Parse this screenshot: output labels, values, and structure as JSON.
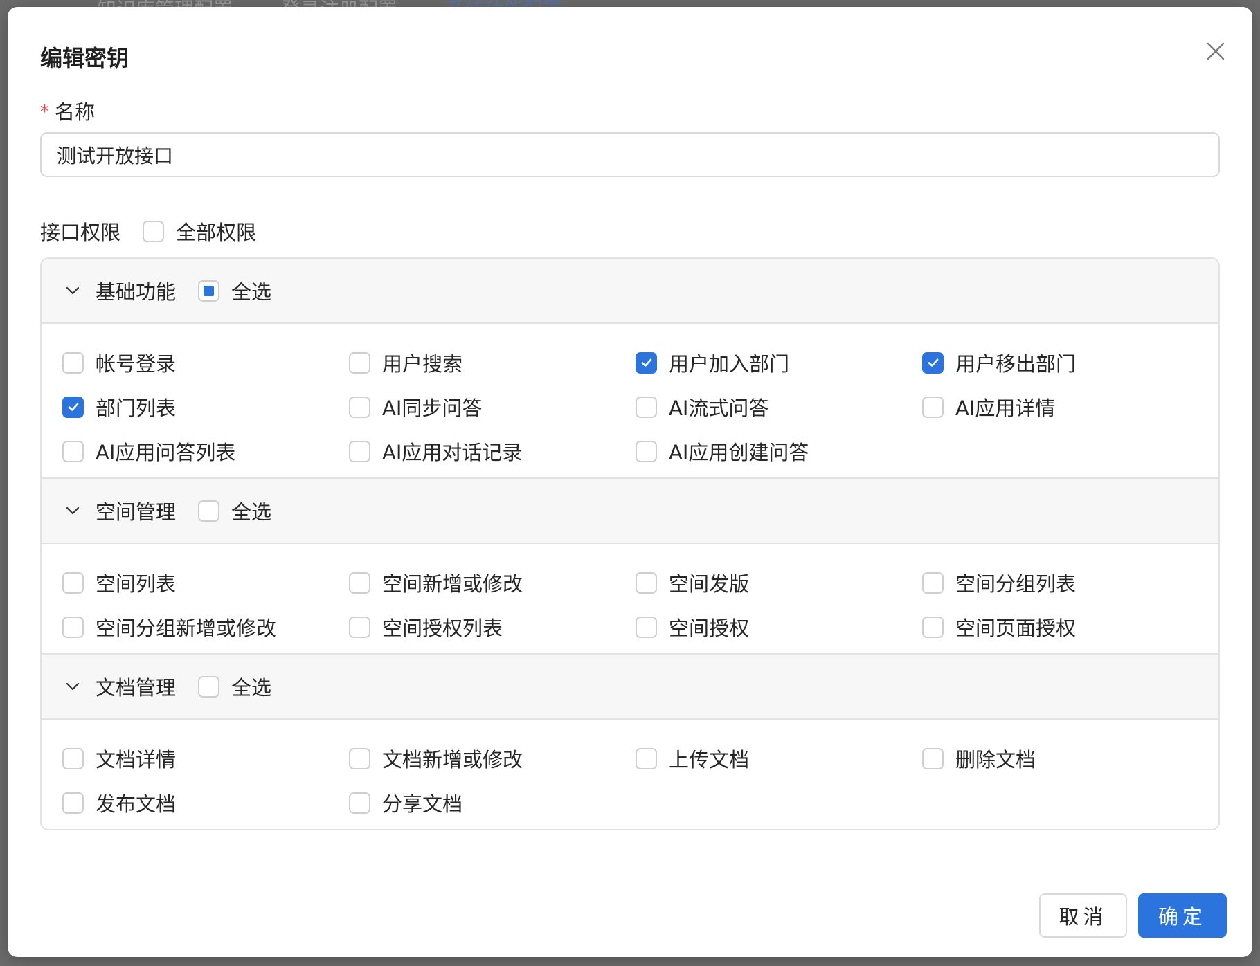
{
  "background_tabs": [
    "知识库管理配置",
    "登录注册配置",
    "系统功能配置"
  ],
  "modal": {
    "title": "编辑密钥",
    "name_label": "名称",
    "required_mark": "*",
    "name_value": "测试开放接口",
    "perm_label": "接口权限",
    "all_perm_label": "全部权限",
    "all_perm_checked": false
  },
  "groups": [
    {
      "title": "基础功能",
      "select_all_label": "全选",
      "select_all_state": "indeterminate",
      "items": [
        {
          "label": "帐号登录",
          "checked": false
        },
        {
          "label": "用户搜索",
          "checked": false
        },
        {
          "label": "用户加入部门",
          "checked": true
        },
        {
          "label": "用户移出部门",
          "checked": true
        },
        {
          "label": "部门列表",
          "checked": true
        },
        {
          "label": "AI同步问答",
          "checked": false
        },
        {
          "label": "AI流式问答",
          "checked": false
        },
        {
          "label": "AI应用详情",
          "checked": false
        },
        {
          "label": "AI应用问答列表",
          "checked": false
        },
        {
          "label": "AI应用对话记录",
          "checked": false
        },
        {
          "label": "AI应用创建问答",
          "checked": false
        }
      ]
    },
    {
      "title": "空间管理",
      "select_all_label": "全选",
      "select_all_state": "unchecked",
      "items": [
        {
          "label": "空间列表",
          "checked": false
        },
        {
          "label": "空间新增或修改",
          "checked": false
        },
        {
          "label": "空间发版",
          "checked": false
        },
        {
          "label": "空间分组列表",
          "checked": false
        },
        {
          "label": "空间分组新增或修改",
          "checked": false
        },
        {
          "label": "空间授权列表",
          "checked": false
        },
        {
          "label": "空间授权",
          "checked": false
        },
        {
          "label": "空间页面授权",
          "checked": false
        }
      ]
    },
    {
      "title": "文档管理",
      "select_all_label": "全选",
      "select_all_state": "unchecked",
      "items": [
        {
          "label": "文档详情",
          "checked": false
        },
        {
          "label": "文档新增或修改",
          "checked": false
        },
        {
          "label": "上传文档",
          "checked": false
        },
        {
          "label": "删除文档",
          "checked": false
        },
        {
          "label": "发布文档",
          "checked": false
        },
        {
          "label": "分享文档",
          "checked": false
        }
      ]
    }
  ],
  "footer": {
    "cancel_label": "取消",
    "ok_label": "确定"
  },
  "colors": {
    "primary": "#2c74dd",
    "required": "#f04848"
  },
  "icons": {
    "close": "close-icon",
    "collapse": "chevron-down-icon",
    "check": "check-icon"
  }
}
